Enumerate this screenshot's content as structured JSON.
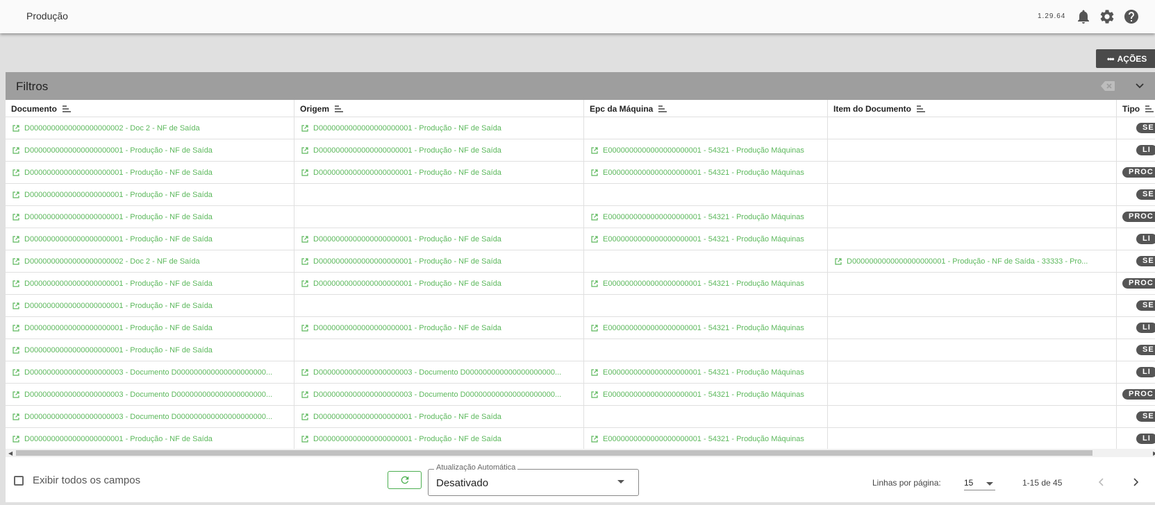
{
  "app": {
    "title": "Produção",
    "version": "1.29.64"
  },
  "toolbar": {
    "acoes_label": "AÇÕES"
  },
  "filters": {
    "title": "Filtros"
  },
  "table": {
    "columns": [
      "Documento",
      "Origem",
      "Epc da Máquina",
      "Item do Documento",
      "Tipo"
    ],
    "rows": [
      {
        "doc": "D0000000000000000000002 - Doc 2 - NF de Saída",
        "origem": "D0000000000000000000001 - Produção - NF de Saída",
        "epc": "",
        "item": "",
        "tipo": "SE"
      },
      {
        "doc": "D0000000000000000000001 - Produção - NF de Saída",
        "origem": "D0000000000000000000001 - Produção - NF de Saída",
        "epc": "E0000000000000000000001 - 54321 - Produção Máquinas",
        "item": "",
        "tipo": "LI"
      },
      {
        "doc": "D0000000000000000000001 - Produção - NF de Saída",
        "origem": "D0000000000000000000001 - Produção - NF de Saída",
        "epc": "E0000000000000000000001 - 54321 - Produção Máquinas",
        "item": "",
        "tipo": "PROC"
      },
      {
        "doc": "D0000000000000000000001 - Produção - NF de Saída",
        "origem": "",
        "epc": "",
        "item": "",
        "tipo": "SE"
      },
      {
        "doc": "D0000000000000000000001 - Produção - NF de Saída",
        "origem": "",
        "epc": "E0000000000000000000001 - 54321 - Produção Máquinas",
        "item": "",
        "tipo": "PROC"
      },
      {
        "doc": "D0000000000000000000001 - Produção - NF de Saída",
        "origem": "D0000000000000000000001 - Produção - NF de Saída",
        "epc": "E0000000000000000000001 - 54321 - Produção Máquinas",
        "item": "",
        "tipo": "LI"
      },
      {
        "doc": "D0000000000000000000002 - Doc 2 - NF de Saída",
        "origem": "D0000000000000000000001 - Produção - NF de Saída",
        "epc": "",
        "item": "D0000000000000000000001 - Produção - NF de Saída - 33333 - Pro...",
        "tipo": "SE"
      },
      {
        "doc": "D0000000000000000000001 - Produção - NF de Saída",
        "origem": "D0000000000000000000001 - Produção - NF de Saída",
        "epc": "E0000000000000000000001 - 54321 - Produção Máquinas",
        "item": "",
        "tipo": "PROC"
      },
      {
        "doc": "D0000000000000000000001 - Produção - NF de Saída",
        "origem": "",
        "epc": "",
        "item": "",
        "tipo": "SE"
      },
      {
        "doc": "D0000000000000000000001 - Produção - NF de Saída",
        "origem": "D0000000000000000000001 - Produção - NF de Saída",
        "epc": "E0000000000000000000001 - 54321 - Produção Máquinas",
        "item": "",
        "tipo": "LI"
      },
      {
        "doc": "D0000000000000000000001 - Produção - NF de Saída",
        "origem": "",
        "epc": "",
        "item": "",
        "tipo": "SE"
      },
      {
        "doc": "D0000000000000000000003 - Documento D000000000000000000000...",
        "origem": "D0000000000000000000003 - Documento D000000000000000000000...",
        "epc": "E0000000000000000000001 - 54321 - Produção Máquinas",
        "item": "",
        "tipo": "LI"
      },
      {
        "doc": "D0000000000000000000003 - Documento D000000000000000000000...",
        "origem": "D0000000000000000000003 - Documento D000000000000000000000...",
        "epc": "E0000000000000000000001 - 54321 - Produção Máquinas",
        "item": "",
        "tipo": "PROC"
      },
      {
        "doc": "D0000000000000000000003 - Documento D000000000000000000000...",
        "origem": "D0000000000000000000001 - Produção - NF de Saída",
        "epc": "",
        "item": "",
        "tipo": "SE"
      },
      {
        "doc": "D0000000000000000000001 - Produção - NF de Saída",
        "origem": "D0000000000000000000001 - Produção - NF de Saída",
        "epc": "E0000000000000000000001 - 54321 - Produção Máquinas",
        "item": "",
        "tipo": "LI"
      }
    ]
  },
  "footer": {
    "show_all_label": "Exibir todos os campos",
    "auto_update_label": "Atualização Automática",
    "auto_update_value": "Desativado",
    "rows_per_page_label": "Linhas por página:",
    "rows_per_page_value": "15",
    "range": "1-15 de 45"
  },
  "colors": {
    "link": "#5cb85c",
    "badge": "#555555",
    "header_bar": "#9e9e9e"
  },
  "icons": [
    "bell-icon",
    "gear-icon",
    "help-icon",
    "open-in-new-icon",
    "sort-icon",
    "clear-filter-icon",
    "chevron-down-icon",
    "refresh-icon",
    "chevron-left-icon",
    "chevron-right-icon"
  ]
}
